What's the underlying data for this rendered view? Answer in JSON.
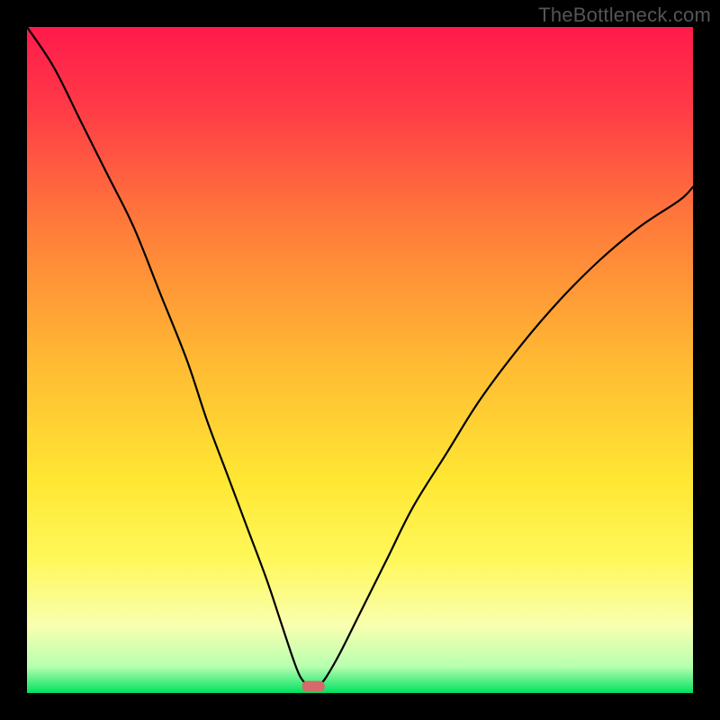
{
  "watermark": "TheBottleneck.com",
  "chart_data": {
    "type": "line",
    "title": "",
    "xlabel": "",
    "ylabel": "",
    "xlim": [
      0,
      100
    ],
    "ylim": [
      0,
      100
    ],
    "background_gradient": {
      "direction": "vertical",
      "stops": [
        {
          "offset": 0.0,
          "color": "#ff1a4b"
        },
        {
          "offset": 0.12,
          "color": "#ff3a47"
        },
        {
          "offset": 0.3,
          "color": "#ff7c3a"
        },
        {
          "offset": 0.5,
          "color": "#ffb933"
        },
        {
          "offset": 0.68,
          "color": "#ffe733"
        },
        {
          "offset": 0.8,
          "color": "#fff85a"
        },
        {
          "offset": 0.9,
          "color": "#f8ffb0"
        },
        {
          "offset": 0.96,
          "color": "#b8ffb0"
        },
        {
          "offset": 1.0,
          "color": "#00e060"
        }
      ]
    },
    "series": [
      {
        "name": "left-branch",
        "x": [
          0,
          4,
          8,
          12,
          16,
          20,
          24,
          27,
          30,
          33,
          36,
          38,
          40,
          41,
          42
        ],
        "y": [
          100,
          94,
          86,
          78,
          70,
          60,
          50,
          41,
          33,
          25,
          17,
          11,
          5,
          2.5,
          1.2
        ]
      },
      {
        "name": "right-branch",
        "x": [
          44,
          45,
          47,
          50,
          54,
          58,
          63,
          68,
          74,
          80,
          86,
          92,
          98,
          100
        ],
        "y": [
          1.2,
          2.5,
          6,
          12,
          20,
          28,
          36,
          44,
          52,
          59,
          65,
          70,
          74,
          76
        ]
      }
    ],
    "marker": {
      "name": "bottleneck-point",
      "shape": "rounded-rect",
      "x": 43,
      "y": 1.0,
      "width_pct": 3.4,
      "height_pct": 1.6,
      "color": "#d46a6a"
    },
    "colors": {
      "frame": "#000000",
      "curve": "#000000",
      "marker": "#d46a6a"
    }
  }
}
